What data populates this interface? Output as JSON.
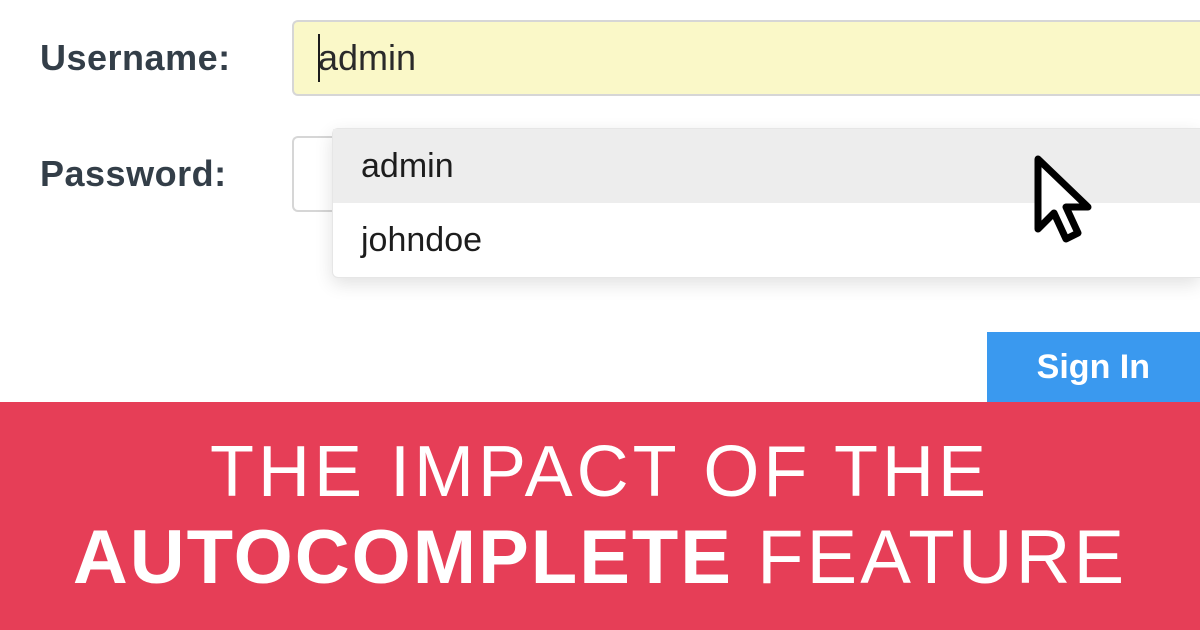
{
  "form": {
    "username_label": "Username:",
    "password_label": "Password:",
    "username_value": "admin",
    "password_value": "",
    "signin_label": "Sign In"
  },
  "autocomplete": {
    "items": [
      "admin",
      "johndoe"
    ]
  },
  "banner": {
    "line1": "THE IMPACT OF THE",
    "line2_bold": "AUTOCOMPLETE",
    "line2_rest": " FEATURE"
  },
  "colors": {
    "accent_red": "#e63e57",
    "accent_blue": "#3a99ef",
    "input_highlight": "#faf8c8"
  }
}
